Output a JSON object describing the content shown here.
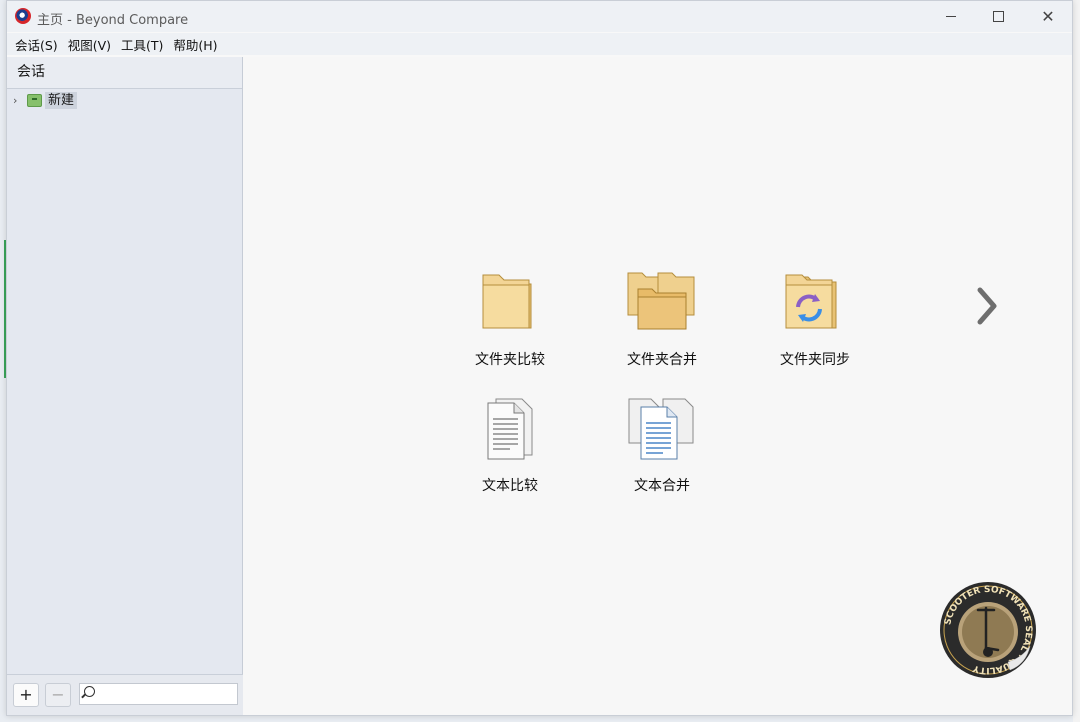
{
  "window": {
    "title": "主页 - Beyond Compare"
  },
  "menu": [
    "会话(S)",
    "视图(V)",
    "工具(T)",
    "帮助(H)"
  ],
  "sidebar": {
    "header": "会话",
    "tree": [
      {
        "label": "新建",
        "icon": "session-folder-icon"
      }
    ],
    "search_placeholder": ""
  },
  "tiles": [
    {
      "label": "文件夹比较",
      "icon": "folder-compare-icon"
    },
    {
      "label": "文件夹合并",
      "icon": "folder-merge-icon"
    },
    {
      "label": "文件夹同步",
      "icon": "folder-sync-icon"
    },
    {
      "label": "文本比较",
      "icon": "text-compare-icon"
    },
    {
      "label": "文本合并",
      "icon": "text-merge-icon"
    }
  ],
  "seal": {
    "text": "SCOOTER SOFTWARE SEAL · QUALITY"
  },
  "colors": {
    "folder": "#f0cd86",
    "sync_purple": "#8b5fc5",
    "sync_blue": "#3a8ee6"
  }
}
